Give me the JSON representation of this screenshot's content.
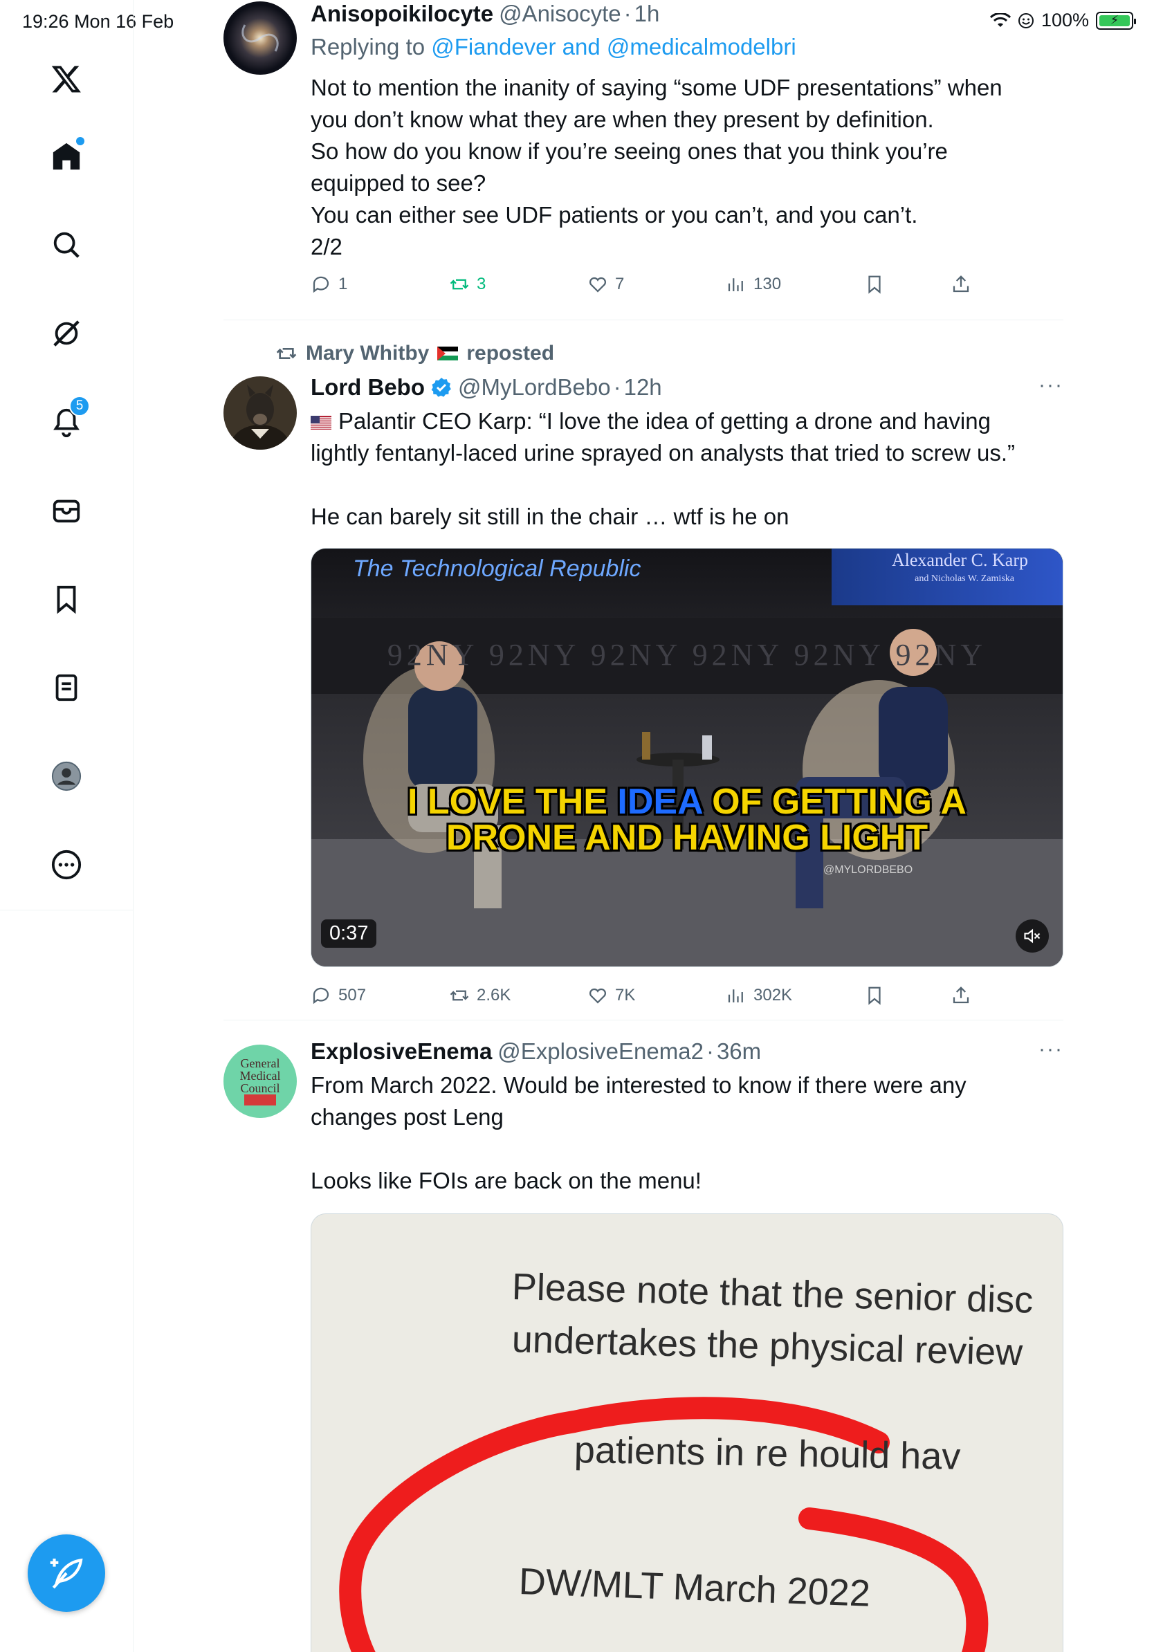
{
  "status_bar": {
    "time": "19:26  Mon 16 Feb",
    "battery": "100%"
  },
  "sidebar": {
    "notifications_badge": "5",
    "items": [
      "home",
      "explore",
      "grok",
      "notifications",
      "messages",
      "bookmarks",
      "lists",
      "profile",
      "more"
    ]
  },
  "tweets": [
    {
      "name": "Anisopoikilocyte",
      "handle": "@Anisocyte",
      "time": "1h",
      "replying_prefix": "Replying to ",
      "replying_to": "@Fiandever and @medicalmodelbri",
      "lines": [
        "Not to mention the inanity of saying “some UDF presentations” when",
        "you don’t know what they are when they present by definition.",
        "So how do you know if you’re seeing ones that you think you’re",
        "equipped to see?",
        "You can either see UDF patients or you can’t, and you can’t.",
        "2/2"
      ],
      "replies": "1",
      "reposts": "3",
      "likes": "7",
      "views": "130"
    },
    {
      "reposted_by": "Mary Whitby",
      "reposted_label": "reposted",
      "name": "Lord Bebo",
      "handle": "@MyLordBebo",
      "time": "12h",
      "lines": [
        "Palantir CEO Karp: “I love the idea of getting a drone and having",
        "lightly fentanyl-laced urine sprayed on analysts that tried to screw us.”",
        "",
        "He can barely sit still in the chair … wtf is he on"
      ],
      "video": {
        "overlay_title": "The Technological Republic",
        "book_author": "Alexander C. Karp",
        "book_coauthor": "and Nicholas W. Zamiska",
        "caption_pre": "I LOVE THE ",
        "caption_highlight": "IDEA",
        "caption_post": " OF GETTING A",
        "caption_line2": "DRONE AND HAVING LIGHT",
        "watermark": "@MYLORDBEBO",
        "backdrop_text": "92NY 92NY 92NY 92NY 92NY 92NY",
        "duration": "0:37"
      },
      "replies": "507",
      "reposts": "2.6K",
      "likes": "7K",
      "views": "302K"
    },
    {
      "name": "ExplosiveEnema",
      "handle": "@ExplosiveEnema2",
      "time": "36m",
      "avatar_text": [
        "General",
        "Medical",
        "Council"
      ],
      "lines": [
        "From March 2022. Would be interested to know if  there were any",
        "changes post Leng",
        "",
        "Looks like FOIs are back on the menu!"
      ],
      "image": {
        "line1": "Please note that the senior disc",
        "line2": "undertakes the physical review",
        "line3": "patients in re        hould hav",
        "line4": "DW/MLT March 2022"
      }
    }
  ],
  "colors": {
    "accent": "#1d9bf0",
    "repost_green": "#00ba7c",
    "muted": "#536471"
  }
}
